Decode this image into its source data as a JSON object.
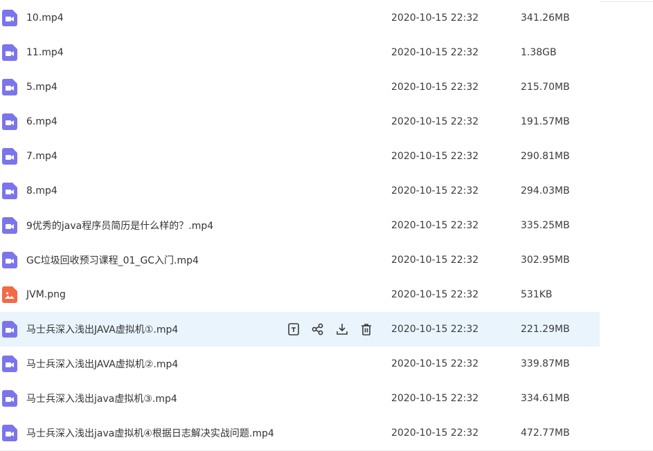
{
  "colors": {
    "video_icon": "#7b75ec",
    "image_icon": "#f36a45",
    "hover_row": "#e9f4fd",
    "action_icon": "#3a3a3a"
  },
  "files": [
    {
      "name": "10.mp4",
      "date": "2020-10-15 22:32",
      "size": "341.26MB",
      "icon": "video-file-icon"
    },
    {
      "name": "11.mp4",
      "date": "2020-10-15 22:32",
      "size": "1.38GB",
      "icon": "video-file-icon"
    },
    {
      "name": "5.mp4",
      "date": "2020-10-15 22:32",
      "size": "215.70MB",
      "icon": "video-file-icon"
    },
    {
      "name": "6.mp4",
      "date": "2020-10-15 22:32",
      "size": "191.57MB",
      "icon": "video-file-icon"
    },
    {
      "name": "7.mp4",
      "date": "2020-10-15 22:32",
      "size": "290.81MB",
      "icon": "video-file-icon"
    },
    {
      "name": "8.mp4",
      "date": "2020-10-15 22:32",
      "size": "294.03MB",
      "icon": "video-file-icon"
    },
    {
      "name": "9优秀的java程序员简历是什么样的？.mp4",
      "date": "2020-10-15 22:32",
      "size": "335.25MB",
      "icon": "video-file-icon"
    },
    {
      "name": "GC垃圾回收预习课程_01_GC入门.mp4",
      "date": "2020-10-15 22:32",
      "size": "302.95MB",
      "icon": "video-file-icon"
    },
    {
      "name": "JVM.png",
      "date": "2020-10-15 22:32",
      "size": "531KB",
      "icon": "image-file-icon"
    },
    {
      "name": "马士兵深入浅出JAVA虚拟机①.mp4",
      "date": "2020-10-15 22:32",
      "size": "221.29MB",
      "icon": "video-file-icon"
    },
    {
      "name": "马士兵深入浅出JAVA虚拟机②.mp4",
      "date": "2020-10-15 22:32",
      "size": "339.87MB",
      "icon": "video-file-icon"
    },
    {
      "name": "马士兵深入浅出java虚拟机③.mp4",
      "date": "2020-10-15 22:32",
      "size": "334.61MB",
      "icon": "video-file-icon"
    },
    {
      "name": "马士兵深入浅出java虚拟机④根据日志解决实战问题.mp4",
      "date": "2020-10-15 22:32",
      "size": "472.77MB",
      "icon": "video-file-icon"
    }
  ],
  "hovered_row_actions": [
    "save-to-icon",
    "share-icon",
    "download-icon",
    "delete-icon"
  ]
}
